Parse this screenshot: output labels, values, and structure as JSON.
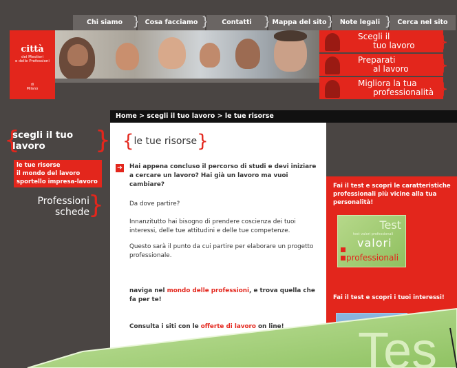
{
  "nav": {
    "tabs": [
      "Chi siamo",
      "Cosa facciamo",
      "Contatti",
      "Mappa del sito",
      "Note legali",
      "Cerca nel sito"
    ]
  },
  "logo": {
    "line1": "città",
    "line2": "dei Mestieri",
    "line3": "e delle Professioni",
    "line4": "di",
    "line5": "Milano"
  },
  "header_buttons": [
    {
      "line1": "Scegli  il",
      "line2": "tuo lavoro"
    },
    {
      "line1": "Preparati",
      "line2": "al lavoro"
    },
    {
      "line1": "Migliora  la  tua",
      "line2": "professionalità"
    }
  ],
  "breadcrumb": "Home > scegli il tuo lavoro > le tue risorse",
  "sidebar": {
    "title": "scegli il tuo lavoro",
    "items": [
      "le tue risorse",
      "il mondo del lavoro",
      "sportello impresa-lavoro"
    ],
    "professioni": "Professioni",
    "schede": "schede"
  },
  "main": {
    "title": "le tue risorse",
    "intro_part1": "Hai appena concluso il percorso di studi e devi iniziare a cercare un lavoro? ",
    "intro_link": "Hai già un lavoro ma vuoi cambiare?",
    "p1": "Da dove partire?",
    "p2": "Innanzitutto hai bisogno di prendere coscienza dei tuoi interessi, delle tue attitudini e delle tue competenze.",
    "p3": "Questo sarà il punto da cui partire per elaborare un progetto professionale.",
    "naviga_pre": "naviga nel ",
    "naviga_link": "mondo delle professioni",
    "naviga_post": ", e trova quella che fa per te!",
    "consulta_pre": "Consulta i siti con le ",
    "consulta_link": "offerte di lavoro",
    "consulta_post": " on line!"
  },
  "right": {
    "promo1": "Fai il test e scopri le caratteristiche professionali più vicine alla tua personalità!",
    "card1": {
      "w1": "Test",
      "w2": "test valori professionali",
      "w3": "valori",
      "w4": "professionali"
    },
    "promo2": "Fai il test e scopri i tuoi interessi!"
  },
  "overlay": {
    "text": "Tes"
  },
  "colors": {
    "brand_red": "#e3261c",
    "dark_gray": "#4a4543",
    "nav_tab": "#6a6563"
  }
}
